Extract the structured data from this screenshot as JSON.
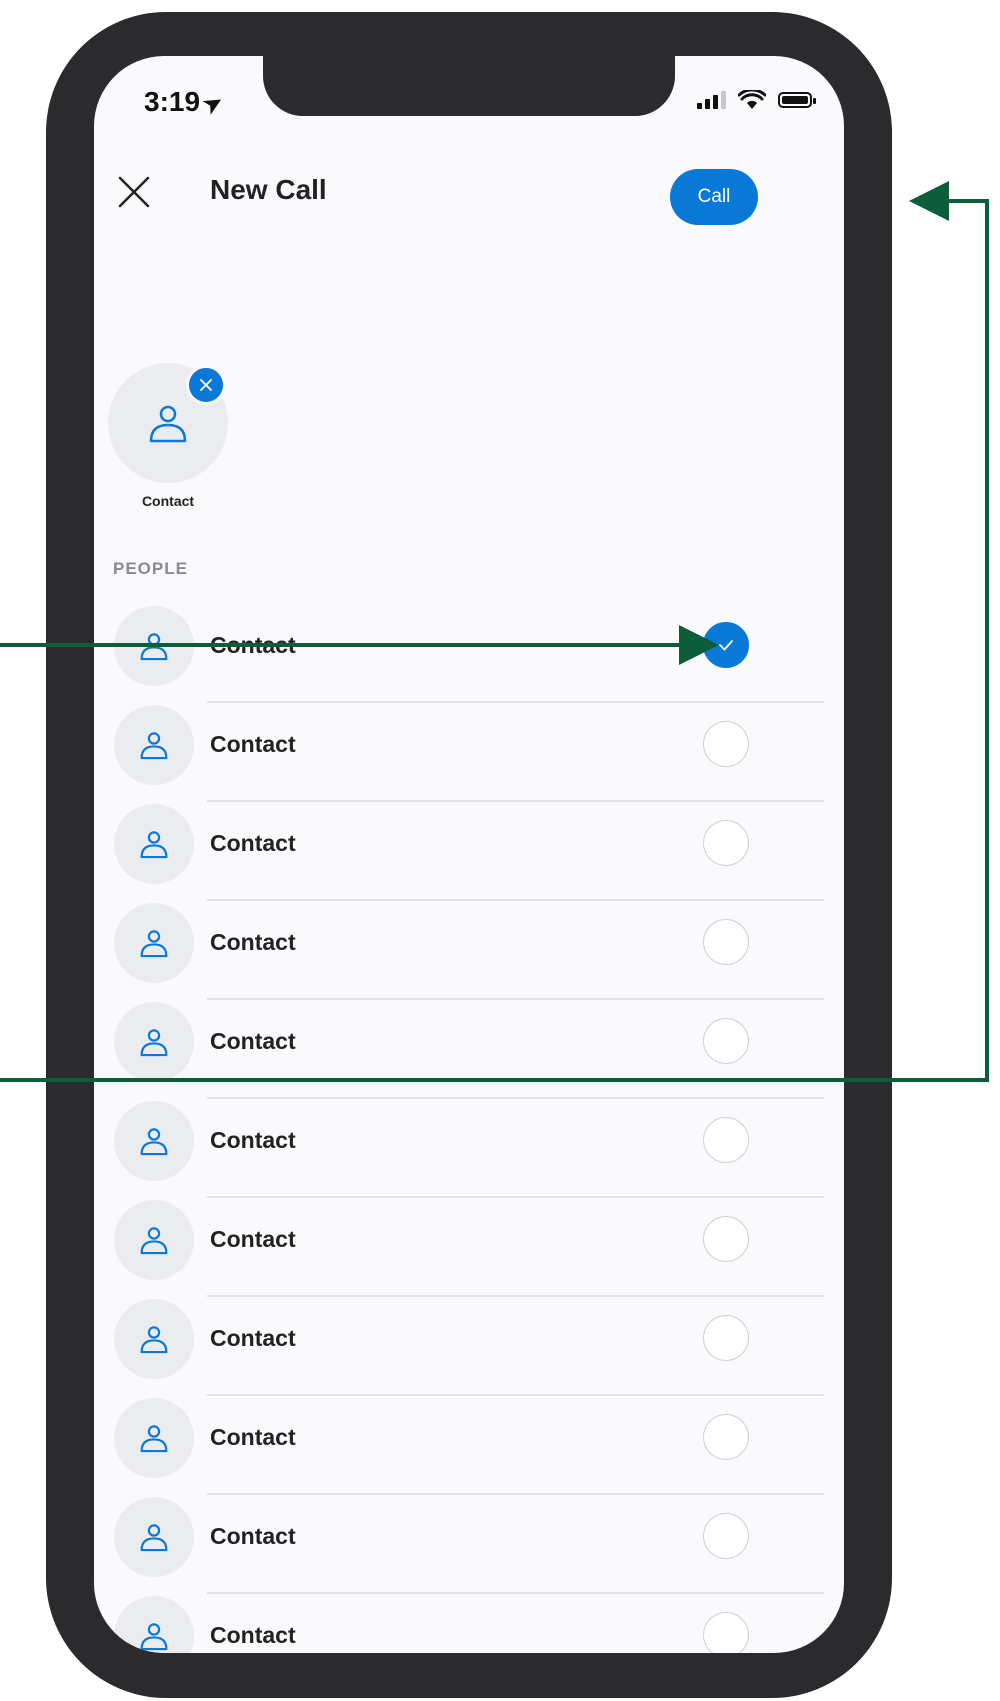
{
  "status_bar": {
    "time": "3:19"
  },
  "header": {
    "title": "New Call",
    "call_label": "Call"
  },
  "selected_chip": {
    "label": "Contact"
  },
  "section_label": "PEOPLE",
  "contacts": [
    {
      "name": "Contact",
      "selected": true
    },
    {
      "name": "Contact",
      "selected": false
    },
    {
      "name": "Contact",
      "selected": false
    },
    {
      "name": "Contact",
      "selected": false
    },
    {
      "name": "Contact",
      "selected": false
    },
    {
      "name": "Contact",
      "selected": false
    },
    {
      "name": "Contact",
      "selected": false
    },
    {
      "name": "Contact",
      "selected": false
    },
    {
      "name": "Contact",
      "selected": false
    },
    {
      "name": "Contact",
      "selected": false
    },
    {
      "name": "Contact",
      "selected": false
    }
  ],
  "colors": {
    "accent": "#0a78d7",
    "annotation": "#0d5c3a",
    "frame": "#2b2b2d"
  }
}
